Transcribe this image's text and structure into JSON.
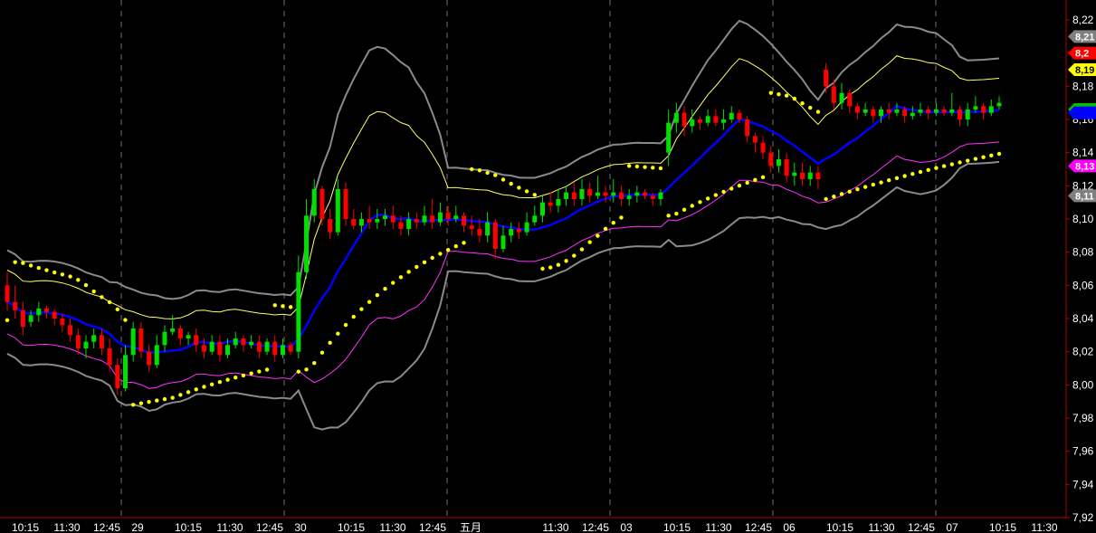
{
  "chart_data": {
    "type": "candlestick",
    "y_ticks": [
      "8,22",
      "8,20",
      "8,18",
      "8,16",
      "8,14",
      "8,12",
      "8,10",
      "8,08",
      "8,06",
      "8,04",
      "8,02",
      "8,00",
      "7,98",
      "7,96",
      "7,94",
      "7,92"
    ],
    "x_ticks": [
      "10:15",
      "11:30",
      "12:45",
      "29",
      "10:15",
      "11:30",
      "12:45",
      "30",
      "10:15",
      "11:30",
      "12:45",
      "五月",
      "11:30",
      "12:45",
      "03",
      "10:15",
      "11:30",
      "12:45",
      "06",
      "10:15",
      "11:30",
      "12:45",
      "07",
      "10:15",
      "11:30"
    ],
    "ylim": [
      7.92,
      8.232
    ],
    "price_badges": [
      {
        "label": "8,21",
        "value": 8.21,
        "fill": "#808080",
        "text": "#ffffff"
      },
      {
        "label": "8,2",
        "value": 8.2,
        "fill": "#ff0000",
        "text": "#ffffff"
      },
      {
        "label": "8,19",
        "value": 8.19,
        "fill": "#ffff00",
        "text": "#000000"
      },
      {
        "label": "8,1",
        "value": 8.166,
        "fill": "#00c000",
        "text": "#ffffff"
      },
      {
        "label": "",
        "value": 8.164,
        "fill": "#0000ff",
        "text": "#ffffff"
      },
      {
        "label": "8,13",
        "value": 8.132,
        "fill": "#ff00ff",
        "text": "#ffffff"
      },
      {
        "label": "8,11",
        "value": 8.114,
        "fill": "#808080",
        "text": "#ffffff"
      }
    ],
    "colors": {
      "up": "#00e000",
      "down": "#ff0000",
      "doji": "#a0a0a0",
      "bands_outer": "#8a8a8a",
      "band_inner_upper": "#ffff66",
      "band_inner_lower": "#ff33ff",
      "ma": "#0000ff",
      "sar": "#ffff00",
      "grid": "#707070",
      "axis": "#b00000"
    },
    "candles": [
      [
        8.06,
        8.05,
        8.068,
        8.045
      ],
      [
        8.05,
        8.045,
        8.06,
        8.04
      ],
      [
        8.045,
        8.035,
        8.05,
        8.03
      ],
      [
        8.038,
        8.042,
        8.045,
        8.035
      ],
      [
        8.042,
        8.046,
        8.05,
        8.038
      ],
      [
        8.046,
        8.044,
        8.048,
        8.04
      ],
      [
        8.044,
        8.04,
        8.046,
        8.036
      ],
      [
        8.04,
        8.036,
        8.043,
        8.032
      ],
      [
        8.036,
        8.03,
        8.04,
        8.026
      ],
      [
        8.03,
        8.022,
        8.034,
        8.018
      ],
      [
        8.022,
        8.026,
        8.03,
        8.016
      ],
      [
        8.026,
        8.03,
        8.034,
        8.022
      ],
      [
        8.03,
        8.022,
        8.034,
        8.018
      ],
      [
        8.022,
        8.012,
        8.028,
        8.008
      ],
      [
        8.012,
        7.998,
        8.016,
        7.994
      ],
      [
        7.998,
        8.018,
        8.024,
        7.996
      ],
      [
        8.018,
        8.034,
        8.038,
        8.014
      ],
      [
        8.034,
        8.02,
        8.038,
        8.016
      ],
      [
        8.02,
        8.012,
        8.024,
        8.008
      ],
      [
        8.012,
        8.024,
        8.03,
        8.01
      ],
      [
        8.024,
        8.032,
        8.036,
        8.02
      ],
      [
        8.032,
        8.034,
        8.042,
        8.03
      ],
      [
        8.034,
        8.028,
        8.036,
        8.024
      ],
      [
        8.028,
        8.03,
        8.032,
        8.024
      ],
      [
        8.03,
        8.024,
        8.034,
        8.02
      ],
      [
        8.024,
        8.02,
        8.028,
        8.016
      ],
      [
        8.02,
        8.026,
        8.03,
        8.018
      ],
      [
        8.026,
        8.018,
        8.03,
        8.014
      ],
      [
        8.018,
        8.024,
        8.028,
        8.016
      ],
      [
        8.024,
        8.028,
        8.032,
        8.022
      ],
      [
        8.028,
        8.024,
        8.03,
        8.02
      ],
      [
        8.024,
        8.026,
        8.03,
        8.022
      ],
      [
        8.026,
        8.02,
        8.03,
        8.016
      ],
      [
        8.02,
        8.026,
        8.028,
        8.018
      ],
      [
        8.026,
        8.018,
        8.03,
        8.014
      ],
      [
        8.018,
        8.024,
        8.028,
        8.016
      ],
      [
        8.024,
        8.02,
        8.026,
        8.018
      ],
      [
        8.02,
        8.068,
        8.078,
        8.016
      ],
      [
        8.068,
        8.102,
        8.112,
        8.064
      ],
      [
        8.102,
        8.118,
        8.124,
        8.098
      ],
      [
        8.118,
        8.1,
        8.12,
        8.096
      ],
      [
        8.1,
        8.092,
        8.106,
        8.088
      ],
      [
        8.092,
        8.118,
        8.124,
        8.09
      ],
      [
        8.118,
        8.1,
        8.122,
        8.096
      ],
      [
        8.1,
        8.096,
        8.106,
        8.094
      ],
      [
        8.096,
        8.1,
        8.104,
        8.092
      ],
      [
        8.1,
        8.098,
        8.108,
        8.094
      ],
      [
        8.098,
        8.1,
        8.106,
        8.094
      ],
      [
        8.1,
        8.102,
        8.106,
        8.096
      ],
      [
        8.102,
        8.098,
        8.108,
        8.094
      ],
      [
        8.098,
        8.094,
        8.102,
        8.09
      ],
      [
        8.094,
        8.1,
        8.104,
        8.09
      ],
      [
        8.1,
        8.098,
        8.104,
        8.094
      ],
      [
        8.098,
        8.102,
        8.108,
        8.096
      ],
      [
        8.102,
        8.098,
        8.112,
        8.094
      ],
      [
        8.098,
        8.104,
        8.11,
        8.096
      ],
      [
        8.104,
        8.1,
        8.108,
        8.096
      ],
      [
        8.1,
        8.102,
        8.108,
        8.098
      ],
      [
        8.102,
        8.096,
        8.104,
        8.092
      ],
      [
        8.096,
        8.094,
        8.102,
        8.09
      ],
      [
        8.094,
        8.09,
        8.1,
        8.086
      ],
      [
        8.09,
        8.098,
        8.104,
        8.086
      ],
      [
        8.098,
        8.082,
        8.1,
        8.076
      ],
      [
        8.082,
        8.09,
        8.096,
        8.08
      ],
      [
        8.09,
        8.094,
        8.098,
        8.086
      ],
      [
        8.094,
        8.092,
        8.098,
        8.088
      ],
      [
        8.092,
        8.098,
        8.104,
        8.09
      ],
      [
        8.098,
        8.102,
        8.108,
        8.096
      ],
      [
        8.102,
        8.11,
        8.114,
        8.098
      ],
      [
        8.11,
        8.108,
        8.116,
        8.104
      ],
      [
        8.108,
        8.112,
        8.118,
        8.104
      ],
      [
        8.112,
        8.116,
        8.12,
        8.108
      ],
      [
        8.116,
        8.112,
        8.122,
        8.108
      ],
      [
        8.112,
        8.118,
        8.124,
        8.108
      ],
      [
        8.118,
        8.114,
        8.122,
        8.11
      ],
      [
        8.114,
        8.116,
        8.126,
        8.112
      ],
      [
        8.116,
        8.114,
        8.12,
        8.11
      ],
      [
        8.114,
        8.116,
        8.124,
        8.11
      ],
      [
        8.116,
        8.112,
        8.12,
        8.108
      ],
      [
        8.112,
        8.114,
        8.118,
        8.108
      ],
      [
        8.114,
        8.116,
        8.12,
        8.11
      ],
      [
        8.116,
        8.114,
        8.118,
        8.112
      ],
      [
        8.114,
        8.112,
        8.116,
        8.108
      ],
      [
        8.112,
        8.116,
        8.118,
        8.108
      ],
      [
        8.14,
        8.158,
        8.166,
        8.132
      ],
      [
        8.158,
        8.164,
        8.17,
        8.152
      ],
      [
        8.164,
        8.156,
        8.168,
        8.15
      ],
      [
        8.156,
        8.16,
        8.166,
        8.152
      ],
      [
        8.16,
        8.158,
        8.162,
        8.154
      ],
      [
        8.158,
        8.162,
        8.166,
        8.156
      ],
      [
        8.162,
        8.158,
        8.166,
        8.156
      ],
      [
        8.158,
        8.16,
        8.166,
        8.154
      ],
      [
        8.16,
        8.164,
        8.168,
        8.158
      ],
      [
        8.164,
        8.16,
        8.166,
        8.158
      ],
      [
        8.16,
        8.15,
        8.162,
        8.146
      ],
      [
        8.15,
        8.146,
        8.152,
        8.14
      ],
      [
        8.146,
        8.14,
        8.15,
        8.136
      ],
      [
        8.14,
        8.132,
        8.144,
        8.128
      ],
      [
        8.132,
        8.136,
        8.142,
        8.128
      ],
      [
        8.136,
        8.126,
        8.14,
        8.122
      ],
      [
        8.126,
        8.128,
        8.134,
        8.12
      ],
      [
        8.128,
        8.124,
        8.134,
        8.12
      ],
      [
        8.124,
        8.128,
        8.132,
        8.12
      ],
      [
        8.128,
        8.124,
        8.132,
        8.118
      ],
      [
        8.19,
        8.18,
        8.194,
        8.176
      ],
      [
        8.18,
        8.17,
        8.184,
        8.166
      ],
      [
        8.17,
        8.176,
        8.182,
        8.166
      ],
      [
        8.176,
        8.168,
        8.178,
        8.164
      ],
      [
        8.168,
        8.164,
        8.17,
        8.16
      ],
      [
        8.164,
        8.166,
        8.17,
        8.162
      ],
      [
        8.166,
        8.162,
        8.168,
        8.158
      ],
      [
        8.162,
        8.166,
        8.168,
        8.158
      ],
      [
        8.166,
        8.164,
        8.17,
        8.16
      ],
      [
        8.164,
        8.166,
        8.17,
        8.162
      ],
      [
        8.166,
        8.162,
        8.168,
        8.158
      ],
      [
        8.162,
        8.164,
        8.168,
        8.16
      ],
      [
        8.164,
        8.166,
        8.17,
        8.162
      ],
      [
        8.166,
        8.164,
        8.168,
        8.16
      ],
      [
        8.164,
        8.166,
        8.17,
        8.162
      ],
      [
        8.166,
        8.164,
        8.168,
        8.162
      ],
      [
        8.164,
        8.166,
        8.176,
        8.162
      ],
      [
        8.166,
        8.16,
        8.168,
        8.156
      ],
      [
        8.16,
        8.166,
        8.17,
        8.156
      ],
      [
        8.166,
        8.168,
        8.174,
        8.164
      ],
      [
        8.168,
        8.164,
        8.17,
        8.16
      ],
      [
        8.164,
        8.168,
        8.172,
        8.162
      ],
      [
        8.168,
        8.17,
        8.174,
        8.166
      ]
    ]
  }
}
